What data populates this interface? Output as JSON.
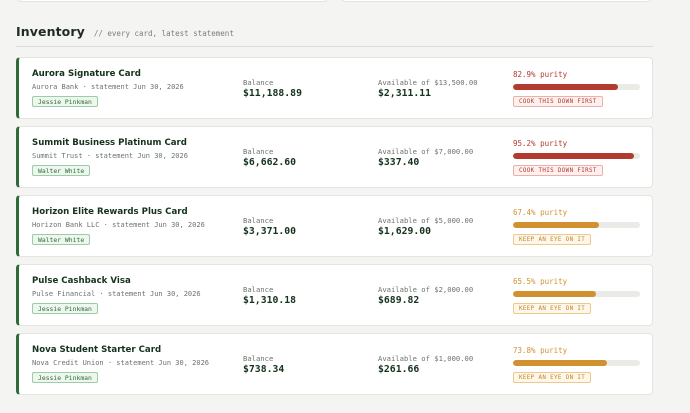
{
  "section": {
    "title": "Inventory",
    "subtitle": "// every card, latest statement"
  },
  "labels": {
    "balance": "Balance"
  },
  "colors": {
    "accent": "#2e6b38",
    "danger": "#b23a2e",
    "warn": "#d1912f",
    "track": "#e9ebe6"
  },
  "cards": [
    {
      "name": "Aurora Signature Card",
      "meta": "Aurora Bank · statement Jun 30, 2026",
      "owner": "Jessie Pinkman",
      "balance": "$11,188.89",
      "available_label": "Available of $13,500.00",
      "available": "$2,311.11",
      "purity_label": "82.9% purity",
      "purity": 0.829,
      "tag": "COOK THIS DOWN FIRST",
      "level": "danger"
    },
    {
      "name": "Summit Business Platinum Card",
      "meta": "Summit Trust · statement Jun 30, 2026",
      "owner": "Walter White",
      "balance": "$6,662.60",
      "available_label": "Available of $7,000.00",
      "available": "$337.40",
      "purity_label": "95.2% purity",
      "purity": 0.952,
      "tag": "COOK THIS DOWN FIRST",
      "level": "danger"
    },
    {
      "name": "Horizon Elite Rewards Plus Card",
      "meta": "Horizon Bank LLC · statement Jun 30, 2026",
      "owner": "Walter White",
      "balance": "$3,371.00",
      "available_label": "Available of $5,000.00",
      "available": "$1,629.00",
      "purity_label": "67.4% purity",
      "purity": 0.674,
      "tag": "KEEP AN EYE ON IT",
      "level": "warn"
    },
    {
      "name": "Pulse Cashback Visa",
      "meta": "Pulse Financial · statement Jun 30, 2026",
      "owner": "Jessie Pinkman",
      "balance": "$1,310.18",
      "available_label": "Available of $2,000.00",
      "available": "$689.82",
      "purity_label": "65.5% purity",
      "purity": 0.655,
      "tag": "KEEP AN EYE ON IT",
      "level": "warn"
    },
    {
      "name": "Nova Student Starter Card",
      "meta": "Nova Credit Union · statement Jun 30, 2026",
      "owner": "Jessie Pinkman",
      "balance": "$738.34",
      "available_label": "Available of $1,000.00",
      "available": "$261.66",
      "purity_label": "73.8% purity",
      "purity": 0.738,
      "tag": "KEEP AN EYE ON IT",
      "level": "warn"
    }
  ]
}
